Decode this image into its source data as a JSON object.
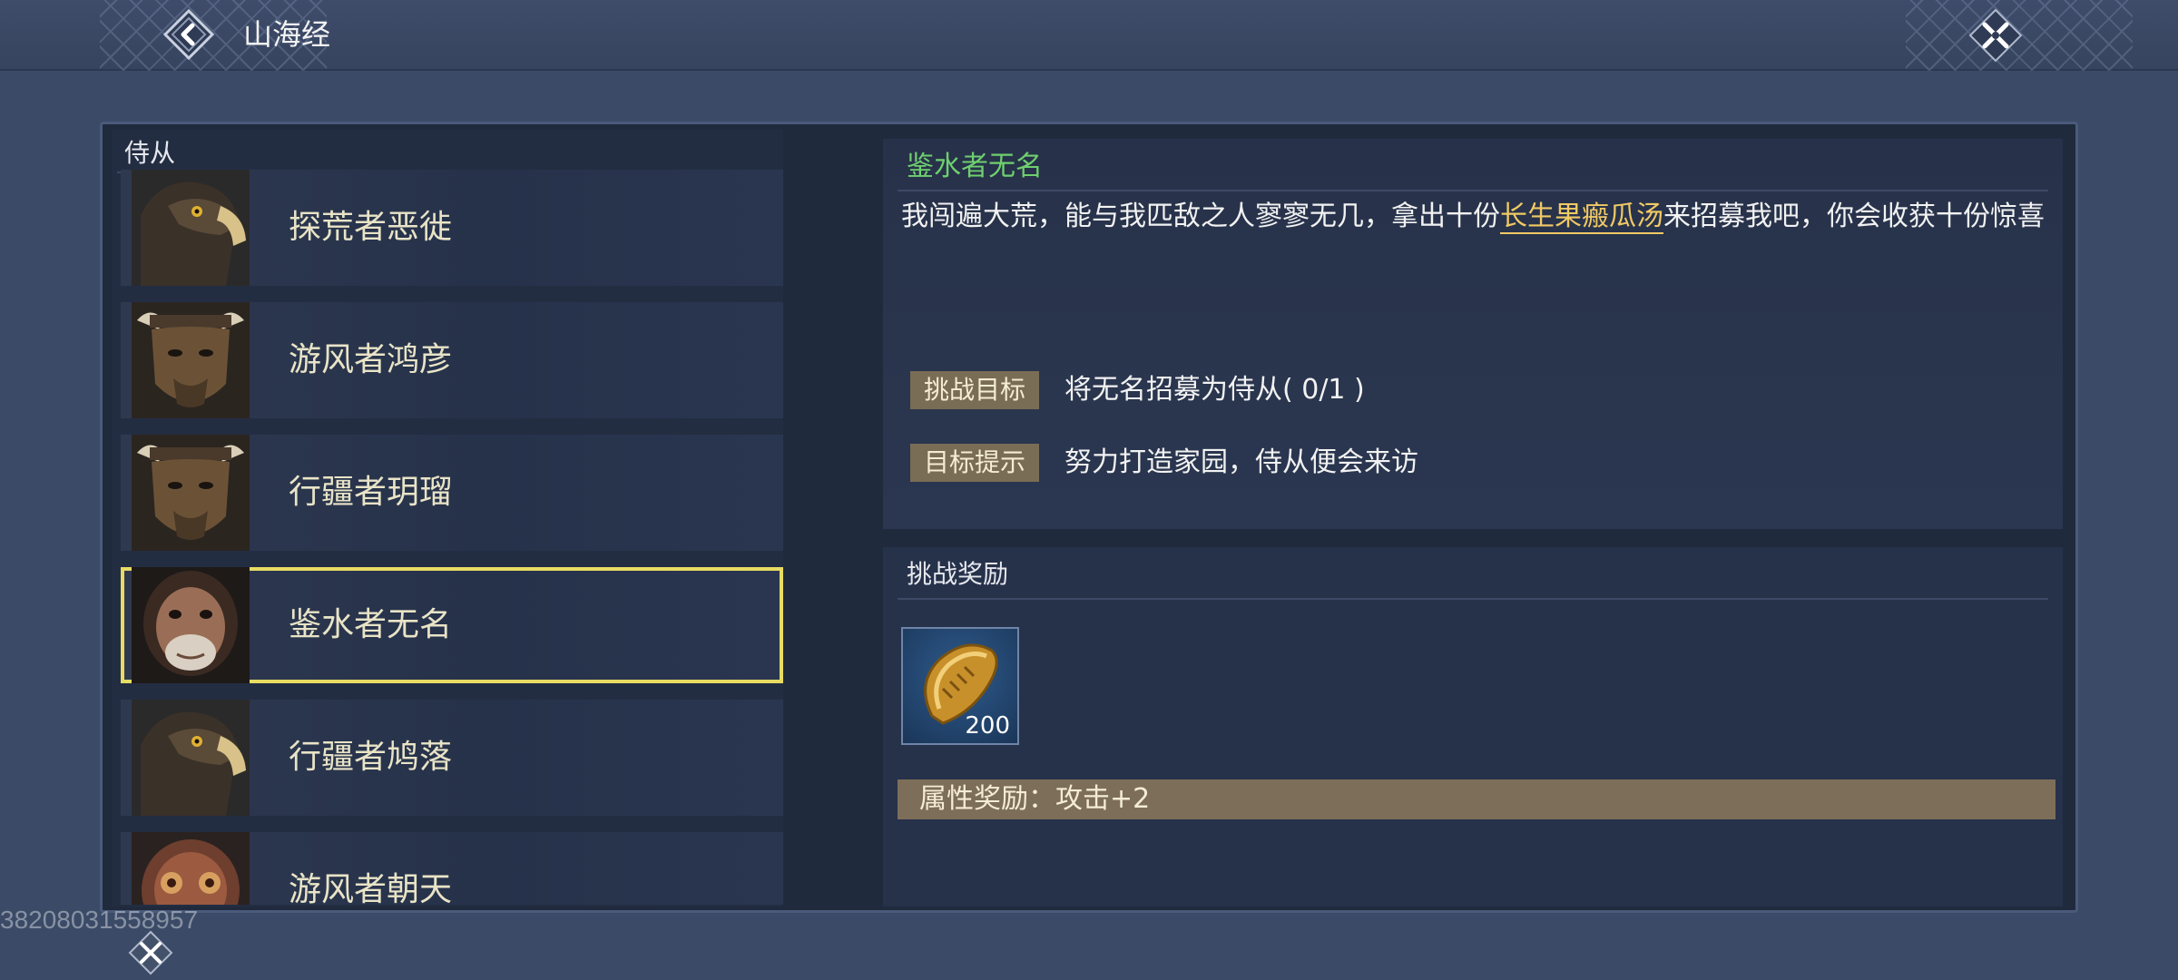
{
  "header": {
    "title": "山海经",
    "back_icon": "back-arrow-icon",
    "close_icon": "close-x-icon"
  },
  "followers": {
    "header": "侍从",
    "items": [
      {
        "name": "探荒者恶徙",
        "portrait": "eagle"
      },
      {
        "name": "游风者鸿彦",
        "portrait": "minotaur"
      },
      {
        "name": "行疆者玥瑠",
        "portrait": "minotaur"
      },
      {
        "name": "鉴水者无名",
        "portrait": "ape",
        "selected": true
      },
      {
        "name": "行疆者鸠落",
        "portrait": "eagle"
      },
      {
        "name": "游风者朝天",
        "portrait": "beetle"
      }
    ]
  },
  "detail": {
    "npc_name": "鉴水者无名",
    "desc_before": "我闯遍大荒，能与我匹敌之人寥寥无几，拿出十份",
    "desc_highlight": "长生果瘢瓜汤",
    "desc_after": "来招募我吧，你会收获十份惊喜",
    "challenge_goal_tag": "挑战目标",
    "challenge_goal_text": "将无名招募为侍从( 0/1 )",
    "goal_hint_tag": "目标提示",
    "goal_hint_text": "努力打造家园，侍从便会来访"
  },
  "reward": {
    "title": "挑战奖励",
    "item_icon": "golden-seed-icon",
    "item_count": "200",
    "attr_text": "属性奖励：攻击+2"
  },
  "watermark": "38208031558957",
  "colors": {
    "background": "#3b4a66",
    "selected_border": "#e8dc63",
    "npc_name": "#6fcf6f",
    "highlight": "#f1c965",
    "tag_bg": "#7a6d55"
  }
}
